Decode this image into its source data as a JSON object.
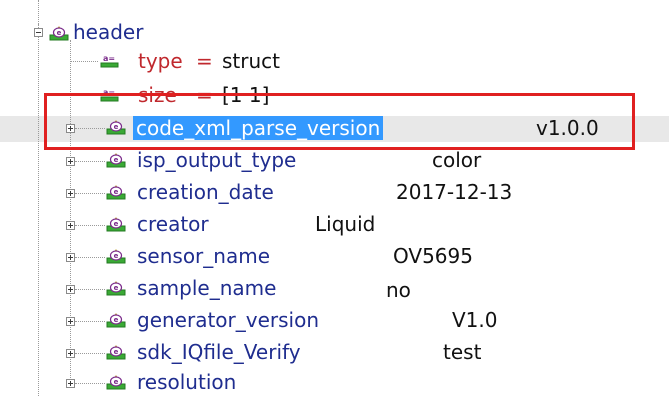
{
  "tree": {
    "root": {
      "label": "header",
      "icon": "element-icon",
      "expanded": true
    },
    "attributes": [
      {
        "name": "type",
        "eq": "=",
        "value": "struct",
        "icon": "attribute-icon"
      },
      {
        "name": "size",
        "eq": "=",
        "value": "[1 1]",
        "icon": "attribute-icon"
      }
    ],
    "children": [
      {
        "label": "code_xml_parse_version",
        "value": "v1.0.0",
        "selected": true
      },
      {
        "label": "isp_output_type",
        "value": "color"
      },
      {
        "label": "creation_date",
        "value": "2017-12-13"
      },
      {
        "label": "creator",
        "value": "Liquid"
      },
      {
        "label": "sensor_name",
        "value": "OV5695"
      },
      {
        "label": "sample_name",
        "value": "no"
      },
      {
        "label": "generator_version",
        "value": "V1.0"
      },
      {
        "label": "sdk_IQfile_Verify",
        "value": "test"
      },
      {
        "label": "resolution",
        "value": ""
      }
    ]
  },
  "colors": {
    "selection": "#3399ff",
    "highlight_box": "#e02020",
    "node_text": "#1f2d8f",
    "attr_text": "#c0282d"
  }
}
